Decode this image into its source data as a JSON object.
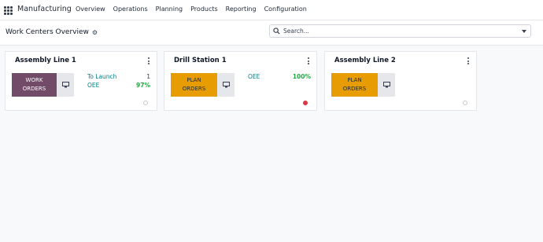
{
  "app": {
    "brand": "Manufacturing"
  },
  "menu": [
    "Overview",
    "Operations",
    "Planning",
    "Products",
    "Reporting",
    "Configuration"
  ],
  "control": {
    "title": "Work Centers Overview",
    "search_placeholder": "Search..."
  },
  "cards": [
    {
      "title": "Assembly Line 1",
      "button_label_line1": "WORK",
      "button_label_line2": "ORDERS",
      "button_color": "#714b67",
      "to_launch_label": "To Launch",
      "to_launch_value": "1",
      "oee_label": "OEE",
      "oee_value": "97%",
      "status": "grey"
    },
    {
      "title": "Drill Station 1",
      "button_label_line1": "PLAN",
      "button_label_line2": "ORDERS",
      "button_color": "#e79c02",
      "oee_label": "OEE",
      "oee_value": "100%",
      "status": "red"
    },
    {
      "title": "Assembly Line 2",
      "button_label_line1": "PLAN",
      "button_label_line2": "ORDERS",
      "button_color": "#e79c02",
      "status": "grey"
    }
  ],
  "icons": {
    "apps": "apps-grid-icon",
    "settings": "gear-icon",
    "search": "search-icon",
    "monitor": "monitor-icon",
    "more": "kebab-icon"
  }
}
